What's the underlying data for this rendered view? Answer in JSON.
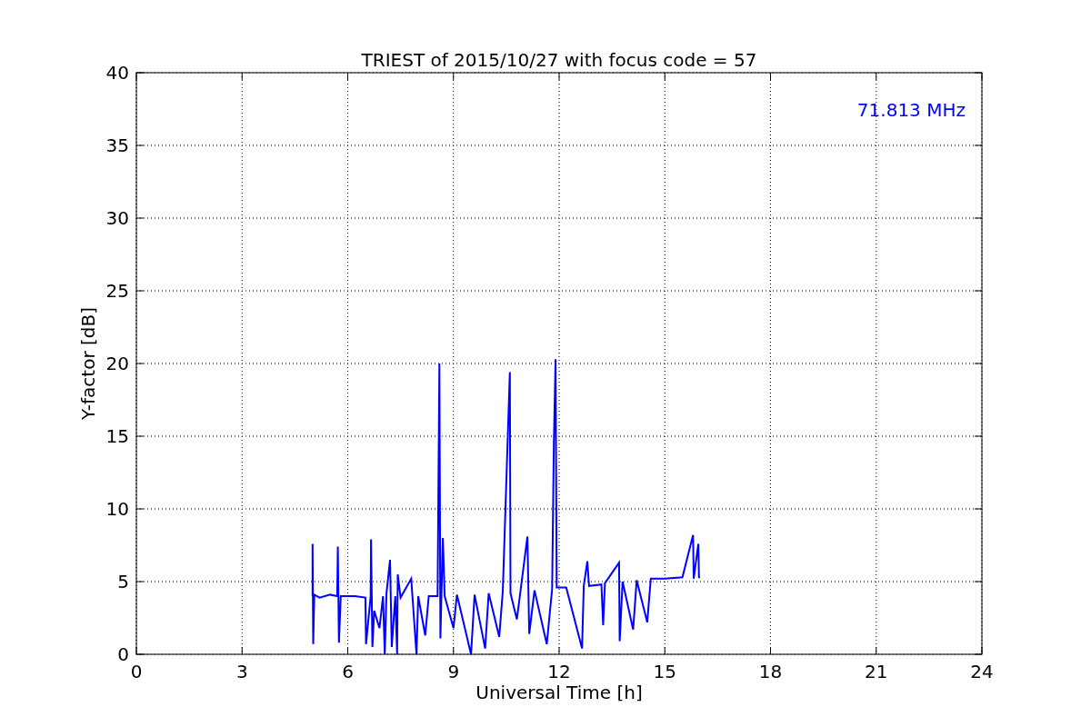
{
  "figure": {
    "chart_data": {
      "type": "line",
      "title": "TRIEST of 2015/10/27 with focus code = 57",
      "xlabel": "Universal Time [h]",
      "ylabel": "Y-factor [dB]",
      "xlim": [
        0,
        24
      ],
      "ylim": [
        0,
        40
      ],
      "xticks": [
        0,
        3,
        6,
        9,
        12,
        15,
        18,
        21,
        24
      ],
      "yticks": [
        0,
        5,
        10,
        15,
        20,
        25,
        30,
        35,
        40
      ],
      "x": [
        5.0,
        5.0,
        5.02,
        5.05,
        5.2,
        5.5,
        5.7,
        5.72,
        5.75,
        5.8,
        6.2,
        6.5,
        6.52,
        6.65,
        6.66,
        6.7,
        6.75,
        6.9,
        7.0,
        7.05,
        7.1,
        7.2,
        7.25,
        7.35,
        7.4,
        7.42,
        7.5,
        7.8,
        7.95,
        8.0,
        8.2,
        8.3,
        8.55,
        8.6,
        8.63,
        8.7,
        8.75,
        9.0,
        9.1,
        9.5,
        9.6,
        9.9,
        10.0,
        10.3,
        10.4,
        10.6,
        10.62,
        10.8,
        10.9,
        11.1,
        11.15,
        11.3,
        11.65,
        11.8,
        11.85,
        11.9,
        11.93,
        12.2,
        12.65,
        12.7,
        12.8,
        12.85,
        13.2,
        13.25,
        13.3,
        13.7,
        13.72,
        13.8,
        14.1,
        14.2,
        14.5,
        14.6,
        15.0,
        15.5,
        15.8,
        15.82,
        15.95,
        15.97,
        16.0
      ],
      "series": [
        {
          "name": "71.813 MHz",
          "color": "#0000ff",
          "values": [
            4.0,
            7.6,
            0.7,
            4.1,
            3.9,
            4.1,
            4.0,
            7.4,
            0.8,
            4.0,
            4.0,
            3.9,
            0.7,
            4.0,
            7.9,
            0.5,
            3.0,
            1.8,
            4.0,
            0.0,
            4.2,
            6.5,
            0.5,
            4.0,
            0.0,
            5.5,
            3.9,
            5.2,
            0.0,
            4.0,
            1.3,
            4.0,
            4.0,
            20.0,
            1.1,
            8.0,
            4.0,
            1.8,
            4.1,
            0.0,
            4.1,
            0.4,
            4.2,
            1.2,
            4.3,
            19.4,
            4.2,
            2.4,
            4.3,
            8.1,
            1.4,
            4.4,
            0.7,
            4.5,
            14.6,
            20.3,
            4.6,
            4.6,
            0.4,
            4.7,
            6.4,
            4.7,
            4.8,
            2.0,
            4.9,
            6.3,
            0.9,
            5.0,
            1.7,
            5.1,
            2.2,
            5.2,
            5.2,
            5.3,
            8.2,
            5.2,
            7.6,
            5.3,
            5.3
          ]
        }
      ],
      "grid": true
    }
  }
}
